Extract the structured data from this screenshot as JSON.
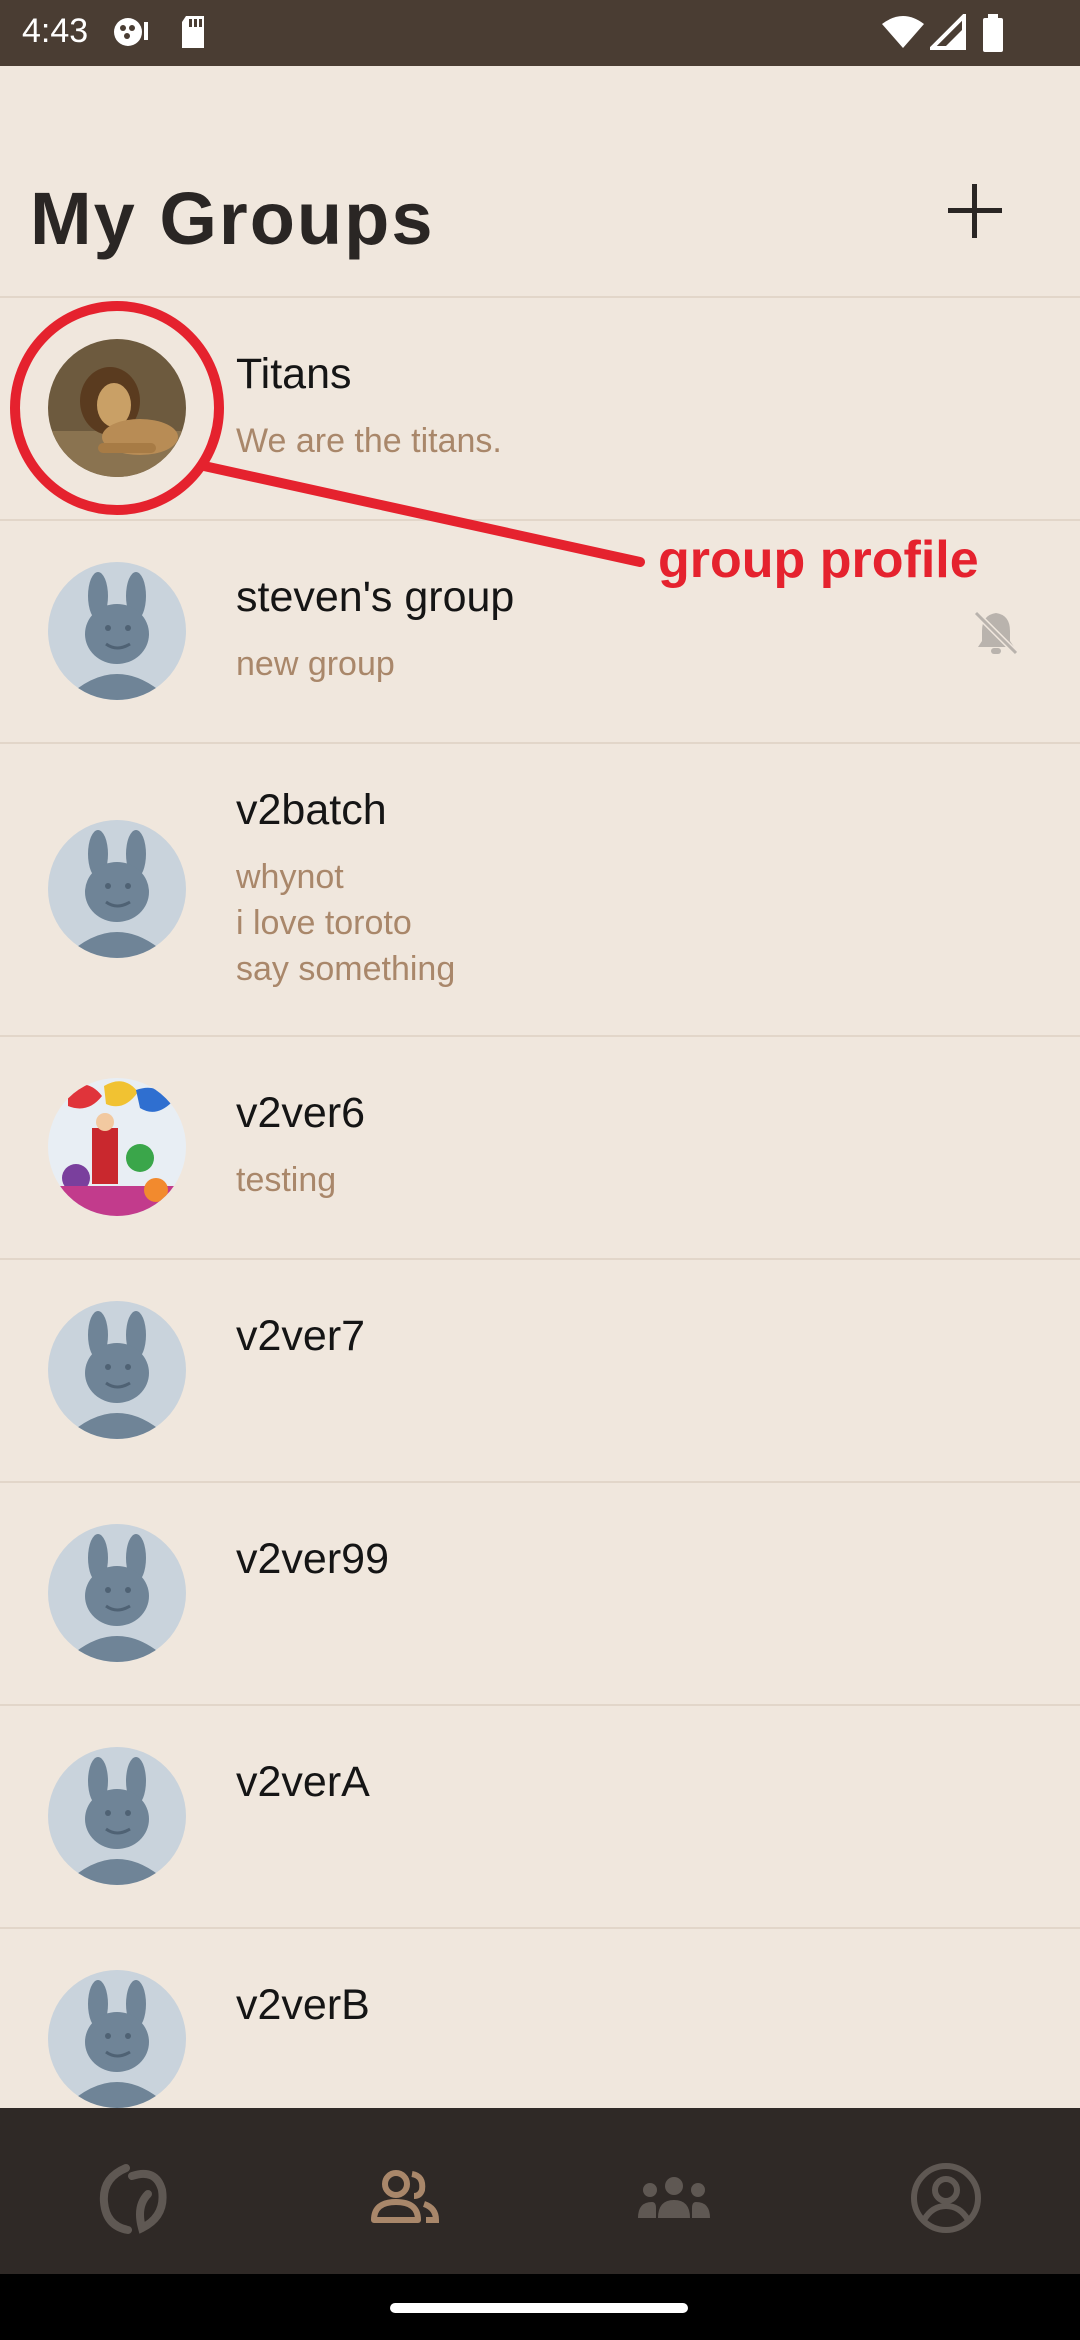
{
  "status_bar": {
    "time": "4:43",
    "icons": [
      "media-icon",
      "sd-card-icon",
      "wifi-icon",
      "signal-icon",
      "battery-icon"
    ]
  },
  "header": {
    "title": "My Groups",
    "add_icon": "plus-icon"
  },
  "groups": [
    {
      "name": "Titans",
      "description": "We are the titans.",
      "avatar": "lion-photo",
      "muted": false
    },
    {
      "name": "steven's group",
      "description": "new group",
      "avatar": "default-avatar",
      "muted": true
    },
    {
      "name": "v2batch",
      "description": "whynot\ni love toroto\nsay something",
      "avatar": "default-avatar",
      "muted": false
    },
    {
      "name": "v2ver6",
      "description": "testing",
      "avatar": "cartoon-characters-photo",
      "muted": false
    },
    {
      "name": "v2ver7",
      "description": "",
      "avatar": "default-avatar",
      "muted": false
    },
    {
      "name": "v2ver99",
      "description": "",
      "avatar": "default-avatar",
      "muted": false
    },
    {
      "name": "v2verA",
      "description": "",
      "avatar": "default-avatar",
      "muted": false
    },
    {
      "name": "v2verB",
      "description": "",
      "avatar": "default-avatar",
      "muted": false
    }
  ],
  "annotation": {
    "label": "group profile",
    "color": "#e5222e"
  },
  "bottom_nav": {
    "items": [
      "home-logo-icon",
      "friends-icon",
      "groups-icon",
      "profile-icon"
    ],
    "active": "friends-icon",
    "active_color": "#a9876a",
    "inactive_color": "#5f5853"
  },
  "colors": {
    "background": "#f0e7dd",
    "status_bar": "#4a3d33",
    "nav_bar": "#2f2926",
    "secondary_text": "#a9876a"
  }
}
